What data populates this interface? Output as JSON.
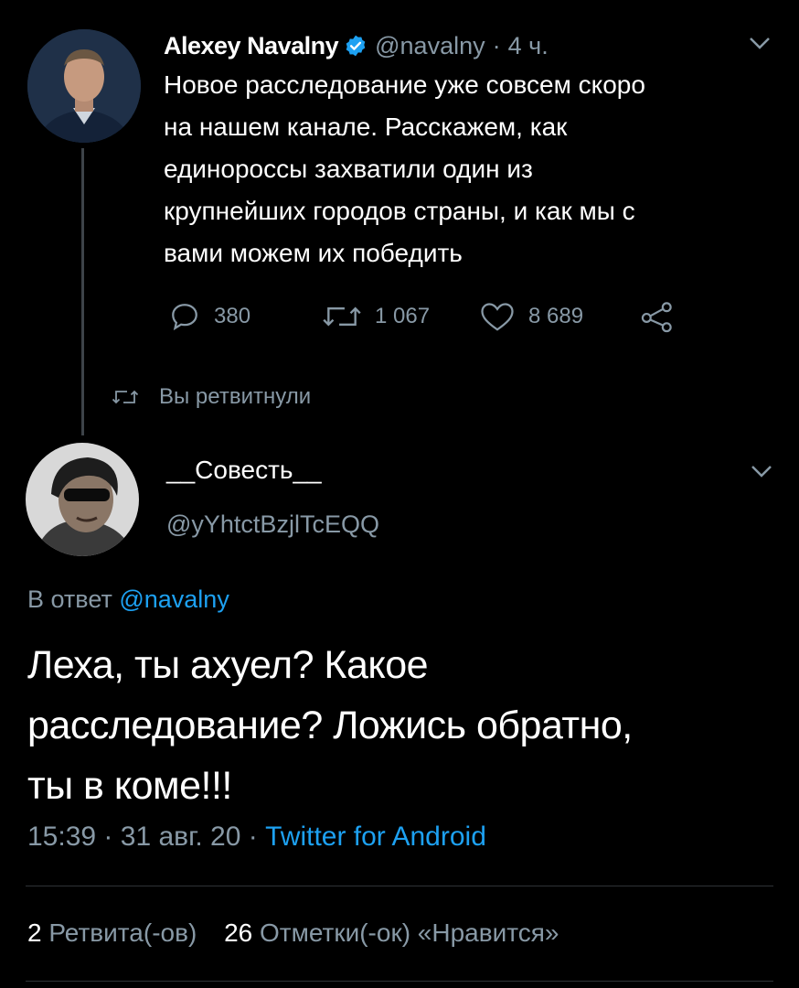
{
  "tweet1": {
    "author_name": "Alexey Navalny",
    "handle": "@navalny",
    "separator": "·",
    "time": "4 ч.",
    "text_lines": [
      "Новое расследование уже совсем скоро",
      "на нашем канале. Расскажем, как",
      "единороссы захватили один из",
      "крупнейших городов страны, и как мы с",
      "вами можем их победить"
    ],
    "replies": "380",
    "retweets": "1 067",
    "likes": "8 689",
    "retweeted_label": "Вы ретвитнули"
  },
  "tweet2": {
    "author_name": "__Совесть__",
    "handle": "@yYhtctBzjlTcEQQ",
    "reply_prefix": "В ответ",
    "reply_handle": "@navalny",
    "text_lines": [
      "Леха, ты ахуел? Какое",
      "расследование? Ложись обратно,",
      "ты в коме!!!"
    ],
    "time": "15:39",
    "dot1": "·",
    "date": "31 авг. 20",
    "dot2": "·",
    "client": "Twitter for Android",
    "retweet_count": "2",
    "retweet_label": "Ретвита(-ов)",
    "like_count": "26",
    "like_label": "Отметки(-ок) «Нравится»"
  },
  "colors": {
    "background": "#000000",
    "muted": "#8899a6",
    "link": "#1da1f2",
    "verified": "#1da1f2"
  }
}
